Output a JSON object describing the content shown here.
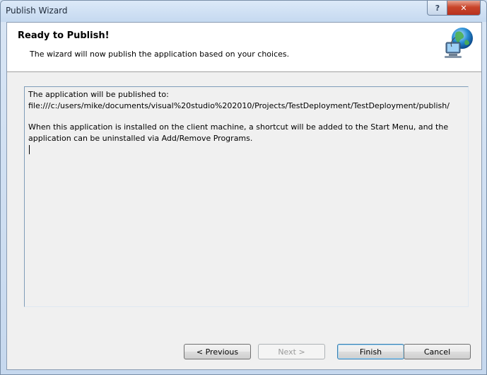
{
  "window": {
    "title": "Publish Wizard"
  },
  "caption_buttons": {
    "help": "?",
    "close": "✕"
  },
  "header": {
    "title": "Ready to Publish!",
    "subtitle": "The wizard will now publish the application based on your choices.",
    "icon": "globe-computer-icon"
  },
  "body": {
    "line1": "The application will be published to:",
    "line2": "file:///c:/users/mike/documents/visual%20studio%202010/Projects/TestDeployment/TestDeployment/publish/",
    "line3": "When this application is installed on the client machine, a shortcut will be added to the Start Menu, and the",
    "line4": "application can be uninstalled via Add/Remove Programs."
  },
  "buttons": {
    "previous": "< Previous",
    "next": "Next >",
    "finish": "Finish",
    "cancel": "Cancel"
  }
}
